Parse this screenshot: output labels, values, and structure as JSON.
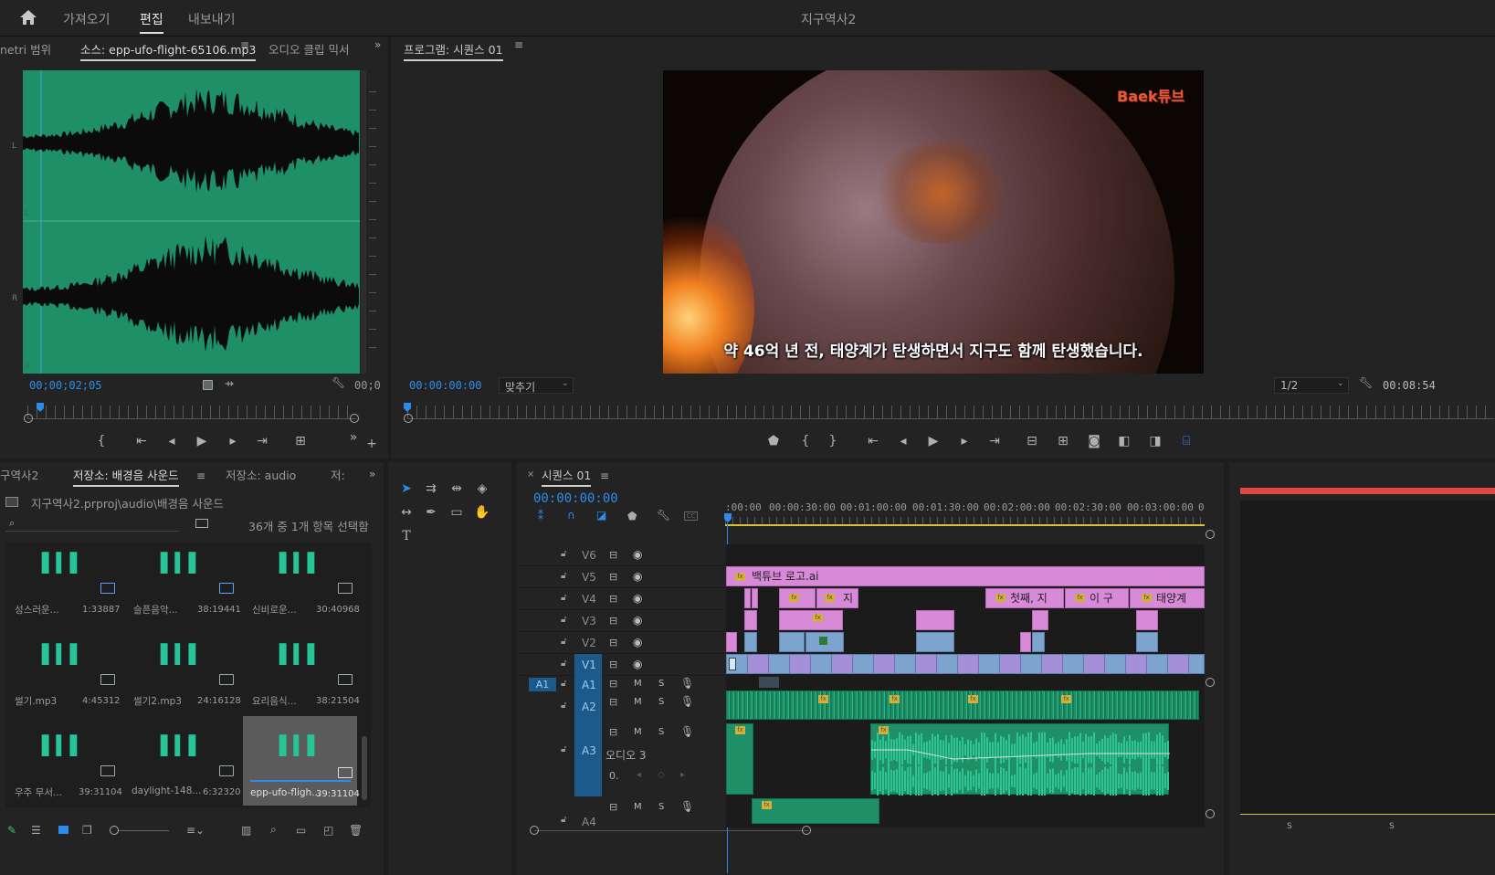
{
  "header": {
    "tabs": [
      "가져오기",
      "편집",
      "내보내기"
    ],
    "active_tab": "편집",
    "project_title": "지구역사2"
  },
  "source_panel": {
    "tabs": [
      "netri 범위",
      "소스: epp-ufo-flight-65106.mp3",
      "오디오 클립 믹서"
    ],
    "timecode": "00;00;02;05",
    "end_timecode": "00;0",
    "channel_labels": [
      "L",
      "L",
      "R",
      "R"
    ]
  },
  "program_panel": {
    "title": "프로그램: 시퀀스 01",
    "timecode": "00:00:00:00",
    "fit_label": "맞추기",
    "zoom_label": "1/2",
    "duration": "00:08:54",
    "video": {
      "watermark": "Baek튜브",
      "subtitle": "약 46억 년 전, 태양계가 탄생하면서 지구도 함께 탄생했습니다."
    }
  },
  "project_panel": {
    "tabs": [
      "구역사2",
      "저장소: 배경음 사운드",
      "저장소: audio",
      "저:"
    ],
    "path": "지구역사2.prproj\\audio\\배경음 사운드",
    "selection_info": "36개 중 1개 항목 선택함",
    "items": [
      {
        "name": "성스러운...",
        "duration": "1:33887"
      },
      {
        "name": "슬픈음악...",
        "duration": "38:19441"
      },
      {
        "name": "신비로운...",
        "duration": "30:40968"
      },
      {
        "name": "썰기.mp3",
        "duration": "4:45312"
      },
      {
        "name": "썰기2.mp3",
        "duration": "24:16128"
      },
      {
        "name": "요리음식...",
        "duration": "38:21504"
      },
      {
        "name": "우주 무서...",
        "duration": "39:31104"
      },
      {
        "name": "daylight-148...",
        "duration": "6:32320"
      },
      {
        "name": "epp-ufo-fligh...",
        "duration": "39:31104"
      }
    ]
  },
  "timeline": {
    "title": "시퀀스 01",
    "timecode": "00:00:00:00",
    "ruler_labels": [
      ":00:00",
      "00:00:30:00",
      "00:01:00:00",
      "00:01:30:00",
      "00:02:00:00",
      "00:02:30:00",
      "00:03:00:00",
      "0"
    ],
    "video_tracks": [
      "V6",
      "V5",
      "V4",
      "V3",
      "V2",
      "V1"
    ],
    "audio_tracks": [
      "A1",
      "A2",
      "A3",
      "A4"
    ],
    "source_patch": "A1",
    "audio_track_name": "오디오 3",
    "audio_volume": "0.",
    "clip_labels": {
      "v5": "백튜브 로고.ai",
      "v4a": "지",
      "v4b": "첫째, 지",
      "v4c": "이 구",
      "v4d": "태양계"
    },
    "mute_label": "M",
    "solo_label": "S"
  },
  "meter": {
    "labels": [
      "S",
      "S"
    ]
  }
}
